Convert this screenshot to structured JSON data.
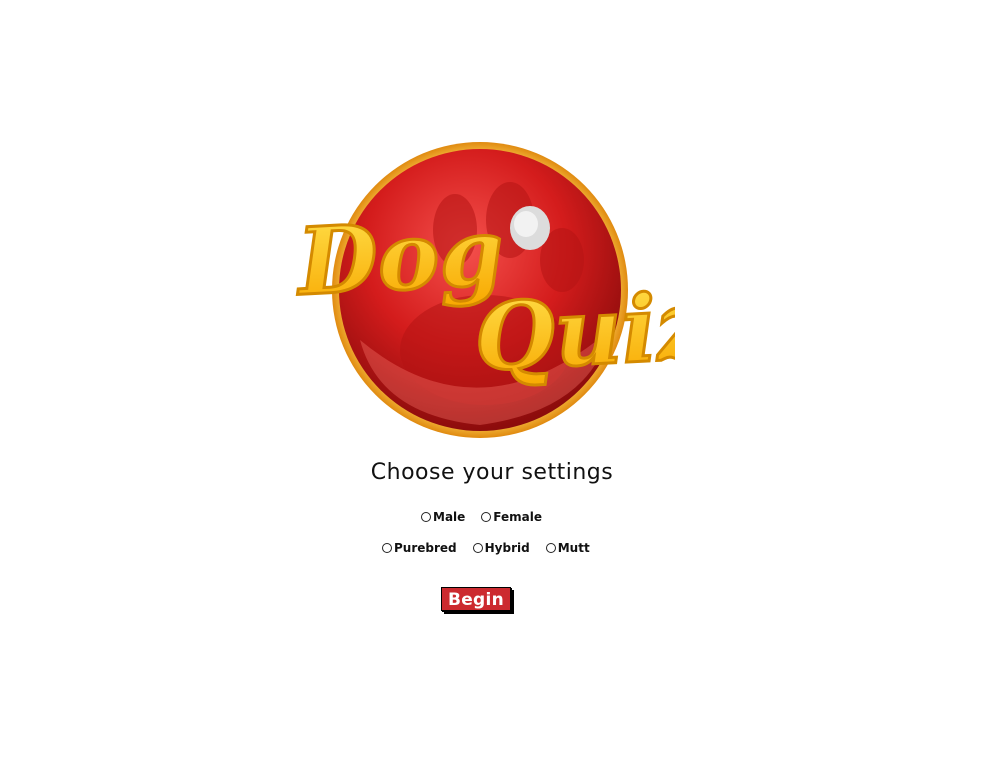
{
  "logo": {
    "word1": "Dog",
    "word2": "Quiz",
    "colors": {
      "ball": "#cc1b1b",
      "ball_highlight": "#f25a55",
      "rim": "#f0b020",
      "text_fill": "#ffc21a",
      "text_stroke": "#d97a00"
    }
  },
  "settings": {
    "heading": "Choose your settings",
    "gender_options": [
      {
        "label": "Male",
        "selected": false
      },
      {
        "label": "Female",
        "selected": false
      }
    ],
    "type_options": [
      {
        "label": "Purebred",
        "selected": false
      },
      {
        "label": "Hybrid",
        "selected": false
      },
      {
        "label": "Mutt",
        "selected": false
      }
    ]
  },
  "begin_button": {
    "label": "Begin",
    "color": "#cc2a2f"
  }
}
